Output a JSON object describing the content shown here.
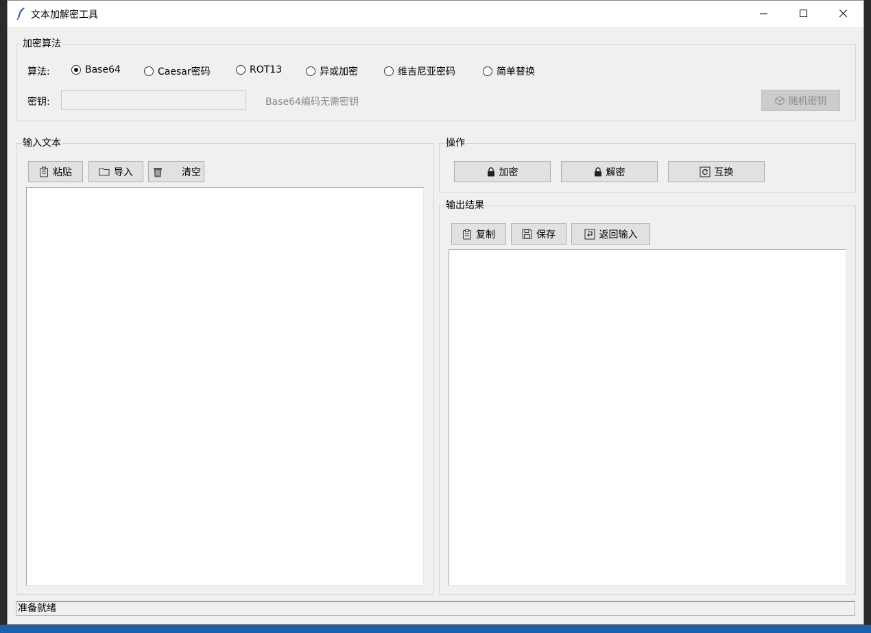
{
  "window": {
    "title": "文本加解密工具"
  },
  "algorithm_group": {
    "label": "加密算法",
    "algo_label": "算法:",
    "options": [
      "Base64",
      "Caesar密码",
      "ROT13",
      "异或加密",
      "维吉尼亚密码",
      "简单替换"
    ],
    "selected": "Base64",
    "key_label": "密钥:",
    "key_value": "",
    "key_hint": "Base64编码无需密钥",
    "random_key_button": "随机密钥"
  },
  "input_group": {
    "label": "输入文本",
    "paste_button": "粘贴",
    "import_button": "导入",
    "clear_button": "清空",
    "text": ""
  },
  "operation_group": {
    "label": "操作",
    "encrypt_button": "加密",
    "decrypt_button": "解密",
    "swap_button": "互换"
  },
  "output_group": {
    "label": "输出结果",
    "copy_button": "复制",
    "save_button": "保存",
    "back_button": "返回输入",
    "text": ""
  },
  "status": {
    "text": "准备就绪"
  }
}
